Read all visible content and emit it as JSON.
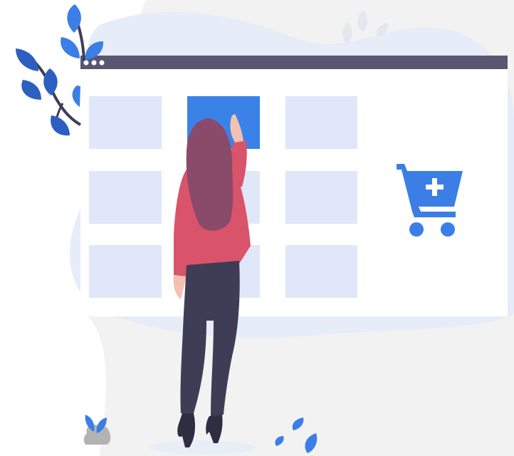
{
  "colors": {
    "blob_light": "#f2f2f2",
    "blob_blue": "#e6ecf8",
    "window_bar": "#5a5671",
    "window_bg": "#ffffff",
    "tile": "#e0e7f8",
    "tile_selected": "#3b82e8",
    "cart": "#3b7ee6",
    "cart_plus": "#ffffff",
    "leaf_dark": "#2c5fc0",
    "leaf_mid": "#3b7ee6",
    "leaf_faded": "#e4e7ee",
    "stem": "#3f3d56",
    "hair": "#8a4a6a",
    "skin": "#f3c0b2",
    "jacket": "#d9536b",
    "pants": "#3f3d56",
    "shoe": "#2f2e41",
    "rock": "#b3b3b3",
    "ground_shadow": "#e8eef8"
  },
  "window": {
    "dots": 3,
    "grid": {
      "rows": 3,
      "cols": 3,
      "selected_index": 1
    }
  },
  "icons": {
    "cart": "cart-add-icon",
    "plant": "plant-icon",
    "person": "person-illustration"
  }
}
